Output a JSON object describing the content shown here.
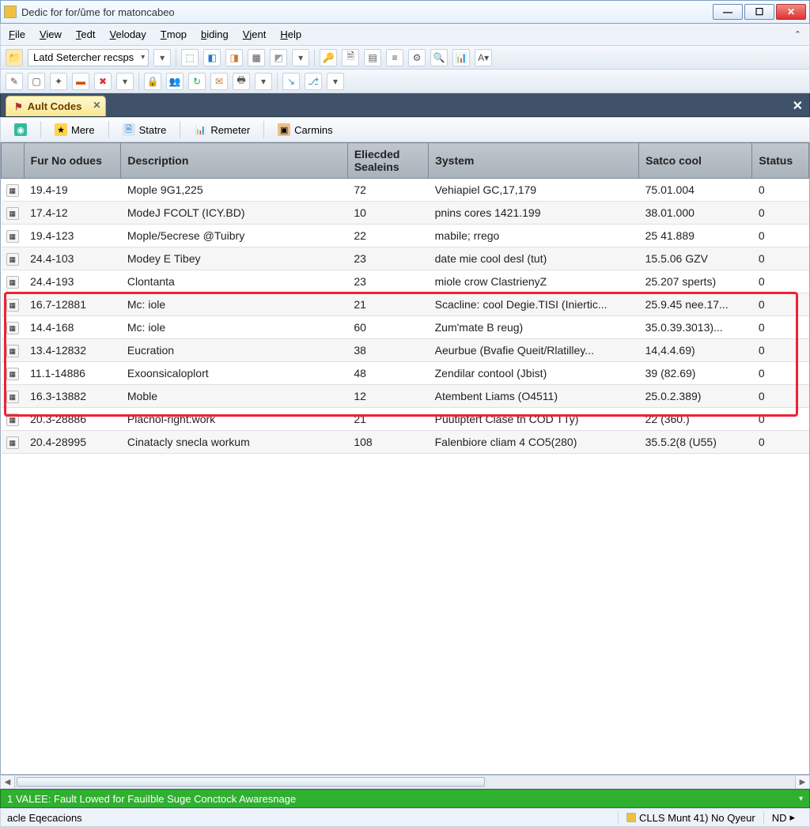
{
  "window": {
    "title": "Dedic for for/ûme for matoncabeo"
  },
  "menu": {
    "items": [
      "File",
      "View",
      "Tedt",
      "Veloday",
      "Tmop",
      "biding",
      "Vjent",
      "Help"
    ]
  },
  "toolbar1": {
    "dropdown_label": "Latd Setercher recsps"
  },
  "tab": {
    "label": "Ault Codes"
  },
  "panel_toolbar": {
    "btn_mere": "Mere",
    "btn_statre": "Statre",
    "btn_remeter": "Remeter",
    "btn_carmins": "Carmins"
  },
  "columns": {
    "icon": "",
    "code": "Fur No odues",
    "desc": "Description",
    "sealings": "Eliecded Sealeins",
    "system": "Зystem",
    "satco": "Satco cool",
    "status": "Status"
  },
  "rows": [
    {
      "code": "19.4-19",
      "desc": "Mople 9G1,225",
      "seal": "72",
      "system": "Vehiapiel GC,17,179",
      "satco": "75.01.004",
      "status": "0"
    },
    {
      "code": "17.4-12",
      "desc": "ModeJ FCOLT (ICY.BD)",
      "seal": "10",
      "system": "pnins cores 1421.199",
      "satco": "38.01.000",
      "status": "0"
    },
    {
      "code": "19.4-123",
      "desc": "Mople/5ecrese @Tuibry",
      "seal": "22",
      "system": "mabile; rrego",
      "satco": "25 41.889",
      "status": "0"
    },
    {
      "code": "24.4-103",
      "desc": "Modey E Tibey",
      "seal": "23",
      "system": "date mie cool desl (tut)",
      "satco": "15.5.06 GZV",
      "status": "0"
    },
    {
      "code": "24.4-193",
      "desc": "Clontanta",
      "seal": "23",
      "system": "miole crow ClastrienyZ",
      "satco": "25.207 sperts)",
      "status": "0"
    },
    {
      "code": "16.7-12881",
      "desc": "Mc: iole",
      "seal": "21",
      "system": "Scacline: cool Degie.TISI (Iniertic...",
      "satco": "25.9.45 nee.17...",
      "status": "0"
    },
    {
      "code": "14.4-168",
      "desc": "Mc: iole",
      "seal": "60",
      "system": "Zum'mate B reug)",
      "satco": "35.0.39.3013)...",
      "status": "0"
    },
    {
      "code": "13.4-12832",
      "desc": "Eucration",
      "seal": "38",
      "system": "Aeurbue (Bvafie Queit/Rlatilley...",
      "satco": "14,4.4.69)",
      "status": "0"
    },
    {
      "code": "11.1-14886",
      "desc": "Exoonsicaloplort",
      "seal": "48",
      "system": "Zendilar contool (Jbist)",
      "satco": "39 (82.69)",
      "status": "0"
    },
    {
      "code": "16.3-13882",
      "desc": "Moble",
      "seal": "12",
      "system": "Atembent Liams (O4511)",
      "satco": "25.0.2.389)",
      "status": "0"
    },
    {
      "code": "20.3-28886",
      "desc": "Placnol-right:work",
      "seal": "21",
      "system": "Puutiptert Clase tn COD TTy)",
      "satco": "22 (360.)",
      "status": "0"
    },
    {
      "code": "20.4-28995",
      "desc": "Cinatacly snecla workum",
      "seal": "108",
      "system": "Falenbiore cliam 4 CO5(280)",
      "satco": "35.5.2(8 (U55)",
      "status": "0"
    }
  ],
  "status_green": "1 VALEE:  Fault Lowed for FauiIble Suge Conctock Awaresnage",
  "status2": {
    "left": "acle Eqecacions",
    "cell1": "CLLS Munt 41) No Qyeur",
    "cell2": "ND"
  }
}
